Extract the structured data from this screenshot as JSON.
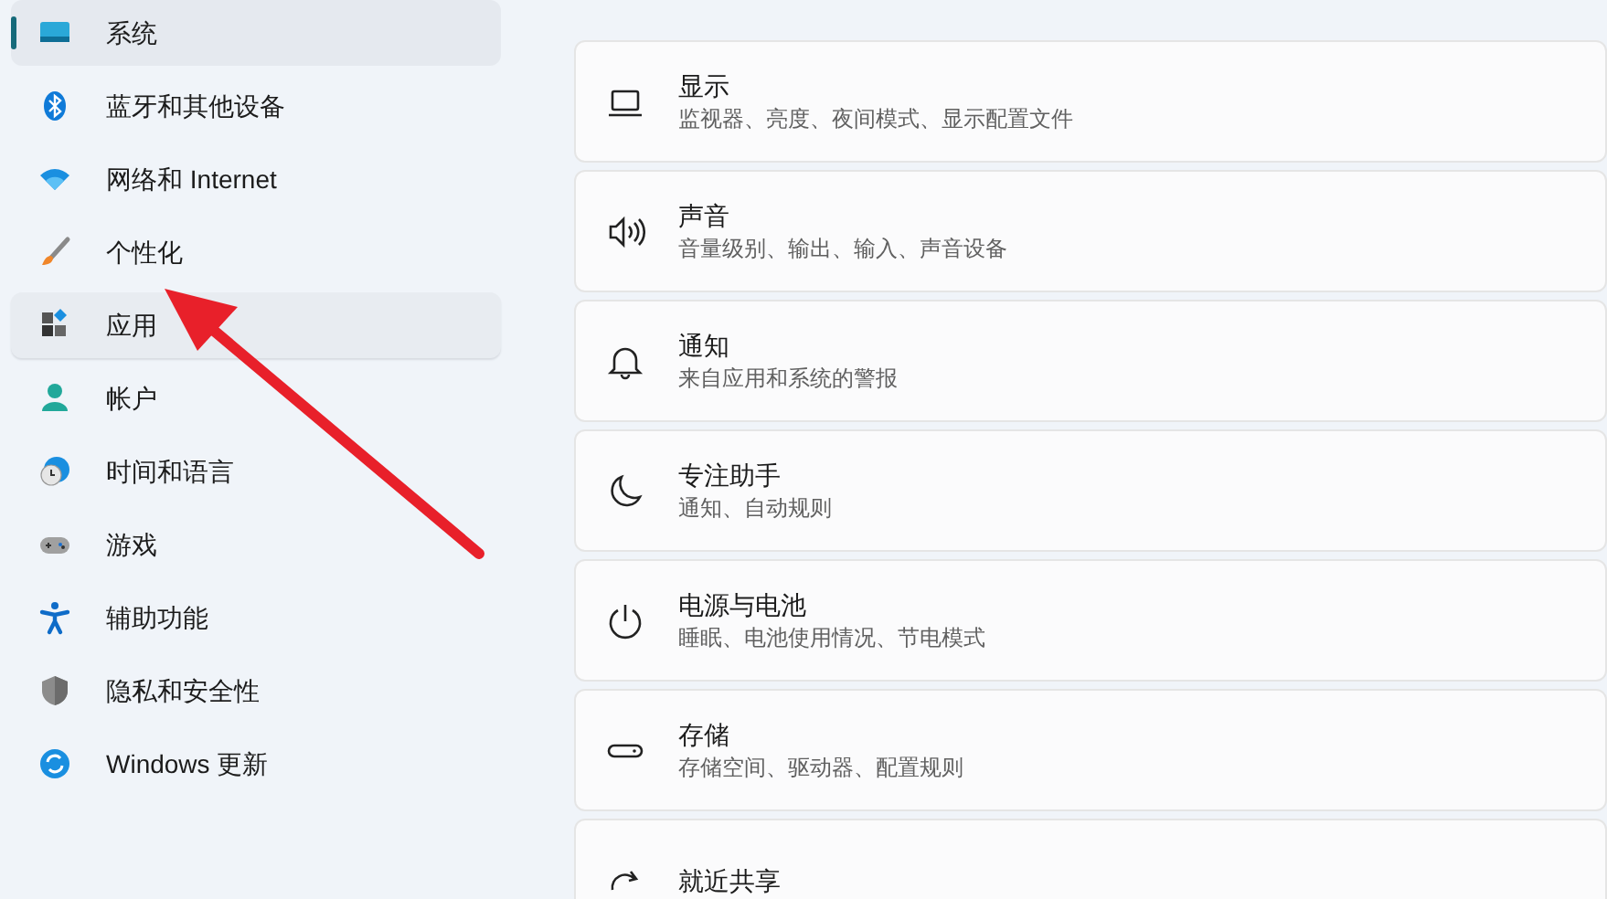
{
  "sidebar": {
    "items": [
      {
        "label": "系统",
        "kind": "system",
        "selected": true,
        "hovered": false
      },
      {
        "label": "蓝牙和其他设备",
        "kind": "bluetooth",
        "selected": false,
        "hovered": false
      },
      {
        "label": "网络和 Internet",
        "kind": "network",
        "selected": false,
        "hovered": false
      },
      {
        "label": "个性化",
        "kind": "brush",
        "selected": false,
        "hovered": false
      },
      {
        "label": "应用",
        "kind": "apps",
        "selected": false,
        "hovered": true
      },
      {
        "label": "帐户",
        "kind": "account",
        "selected": false,
        "hovered": false
      },
      {
        "label": "时间和语言",
        "kind": "time",
        "selected": false,
        "hovered": false
      },
      {
        "label": "游戏",
        "kind": "gaming",
        "selected": false,
        "hovered": false
      },
      {
        "label": "辅助功能",
        "kind": "accessibility",
        "selected": false,
        "hovered": false
      },
      {
        "label": "隐私和安全性",
        "kind": "shield",
        "selected": false,
        "hovered": false
      },
      {
        "label": "Windows 更新",
        "kind": "update",
        "selected": false,
        "hovered": false
      }
    ]
  },
  "settings": [
    {
      "title": "显示",
      "subtitle": "监视器、亮度、夜间模式、显示配置文件",
      "kind": "display"
    },
    {
      "title": "声音",
      "subtitle": "音量级别、输出、输入、声音设备",
      "kind": "sound"
    },
    {
      "title": "通知",
      "subtitle": "来自应用和系统的警报",
      "kind": "bell"
    },
    {
      "title": "专注助手",
      "subtitle": "通知、自动规则",
      "kind": "moon"
    },
    {
      "title": "电源与电池",
      "subtitle": "睡眠、电池使用情况、节电模式",
      "kind": "power"
    },
    {
      "title": "存储",
      "subtitle": "存储空间、驱动器、配置规则",
      "kind": "storage"
    },
    {
      "title": "就近共享",
      "kind": "share"
    }
  ]
}
